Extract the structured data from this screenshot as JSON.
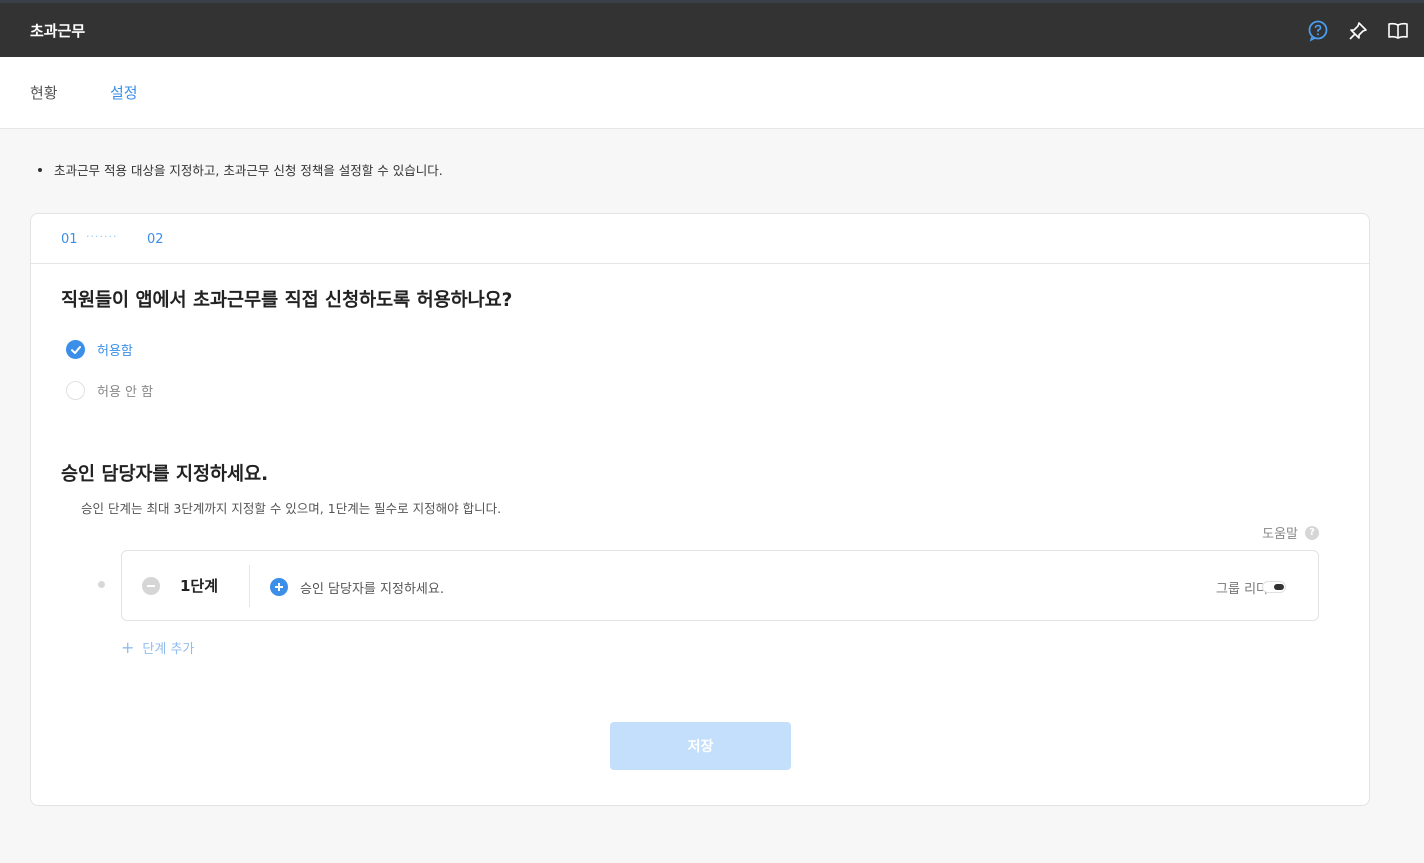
{
  "app": {
    "title": "초과근무"
  },
  "header_icons": [
    "help-circle-icon",
    "pin-icon",
    "book-icon"
  ],
  "tabs": [
    {
      "label": "현황",
      "active": false
    },
    {
      "label": "설정",
      "active": true
    }
  ],
  "notice": "초과근무 적용 대상을 지정하고, 초과근무 신청 정책을 설정할 수 있습니다.",
  "steps": {
    "step1": "01",
    "dots": "·······",
    "step2": "02"
  },
  "question": {
    "title": "직원들이 앱에서 초과근무를 직접 신청하도록 허용하나요?",
    "options": [
      {
        "label": "허용함",
        "checked": true
      },
      {
        "label": "허용 안 함",
        "checked": false
      }
    ]
  },
  "approver": {
    "title": "승인 담당자를 지정하세요.",
    "description": "승인 단계는 최대 3단계까지 지정할 수 있으며, 1단계는 필수로 지정해야 합니다.",
    "help_label": "도움말",
    "help_icon_char": "?",
    "stage": {
      "label": "1단계",
      "assign_placeholder": "승인 담당자를 지정하세요.",
      "group_leader_label": "그룹 리더",
      "group_leader_enabled": false
    },
    "add_step_label": "단계 추가",
    "add_step_plus": "+"
  },
  "save_label": "저장",
  "colors": {
    "accent": "#3b8fe8",
    "topbar": "#333333",
    "save_disabled": "#c3dffb"
  }
}
